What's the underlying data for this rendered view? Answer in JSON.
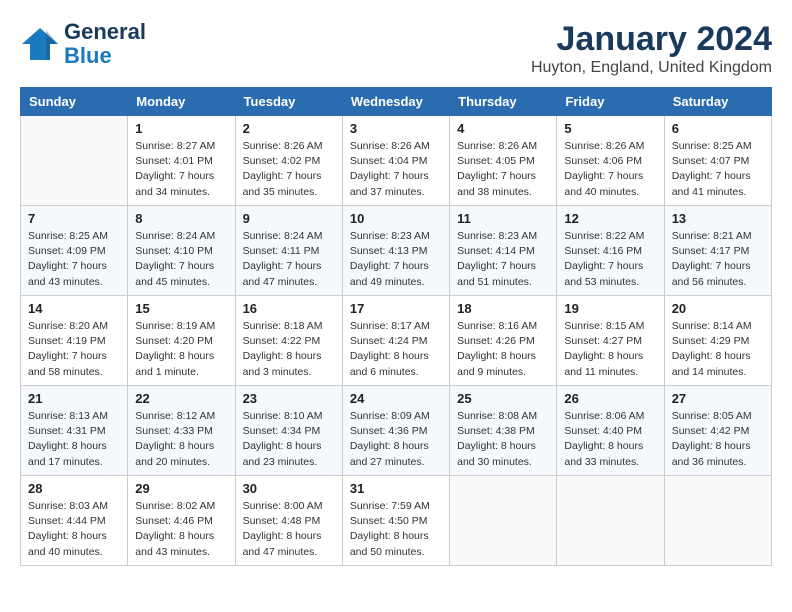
{
  "header": {
    "logo_line1": "General",
    "logo_line2": "Blue",
    "month_year": "January 2024",
    "location": "Huyton, England, United Kingdom"
  },
  "days_of_week": [
    "Sunday",
    "Monday",
    "Tuesday",
    "Wednesday",
    "Thursday",
    "Friday",
    "Saturday"
  ],
  "weeks": [
    [
      {
        "day": "",
        "info": ""
      },
      {
        "day": "1",
        "info": "Sunrise: 8:27 AM\nSunset: 4:01 PM\nDaylight: 7 hours\nand 34 minutes."
      },
      {
        "day": "2",
        "info": "Sunrise: 8:26 AM\nSunset: 4:02 PM\nDaylight: 7 hours\nand 35 minutes."
      },
      {
        "day": "3",
        "info": "Sunrise: 8:26 AM\nSunset: 4:04 PM\nDaylight: 7 hours\nand 37 minutes."
      },
      {
        "day": "4",
        "info": "Sunrise: 8:26 AM\nSunset: 4:05 PM\nDaylight: 7 hours\nand 38 minutes."
      },
      {
        "day": "5",
        "info": "Sunrise: 8:26 AM\nSunset: 4:06 PM\nDaylight: 7 hours\nand 40 minutes."
      },
      {
        "day": "6",
        "info": "Sunrise: 8:25 AM\nSunset: 4:07 PM\nDaylight: 7 hours\nand 41 minutes."
      }
    ],
    [
      {
        "day": "7",
        "info": "Sunrise: 8:25 AM\nSunset: 4:09 PM\nDaylight: 7 hours\nand 43 minutes."
      },
      {
        "day": "8",
        "info": "Sunrise: 8:24 AM\nSunset: 4:10 PM\nDaylight: 7 hours\nand 45 minutes."
      },
      {
        "day": "9",
        "info": "Sunrise: 8:24 AM\nSunset: 4:11 PM\nDaylight: 7 hours\nand 47 minutes."
      },
      {
        "day": "10",
        "info": "Sunrise: 8:23 AM\nSunset: 4:13 PM\nDaylight: 7 hours\nand 49 minutes."
      },
      {
        "day": "11",
        "info": "Sunrise: 8:23 AM\nSunset: 4:14 PM\nDaylight: 7 hours\nand 51 minutes."
      },
      {
        "day": "12",
        "info": "Sunrise: 8:22 AM\nSunset: 4:16 PM\nDaylight: 7 hours\nand 53 minutes."
      },
      {
        "day": "13",
        "info": "Sunrise: 8:21 AM\nSunset: 4:17 PM\nDaylight: 7 hours\nand 56 minutes."
      }
    ],
    [
      {
        "day": "14",
        "info": "Sunrise: 8:20 AM\nSunset: 4:19 PM\nDaylight: 7 hours\nand 58 minutes."
      },
      {
        "day": "15",
        "info": "Sunrise: 8:19 AM\nSunset: 4:20 PM\nDaylight: 8 hours\nand 1 minute."
      },
      {
        "day": "16",
        "info": "Sunrise: 8:18 AM\nSunset: 4:22 PM\nDaylight: 8 hours\nand 3 minutes."
      },
      {
        "day": "17",
        "info": "Sunrise: 8:17 AM\nSunset: 4:24 PM\nDaylight: 8 hours\nand 6 minutes."
      },
      {
        "day": "18",
        "info": "Sunrise: 8:16 AM\nSunset: 4:26 PM\nDaylight: 8 hours\nand 9 minutes."
      },
      {
        "day": "19",
        "info": "Sunrise: 8:15 AM\nSunset: 4:27 PM\nDaylight: 8 hours\nand 11 minutes."
      },
      {
        "day": "20",
        "info": "Sunrise: 8:14 AM\nSunset: 4:29 PM\nDaylight: 8 hours\nand 14 minutes."
      }
    ],
    [
      {
        "day": "21",
        "info": "Sunrise: 8:13 AM\nSunset: 4:31 PM\nDaylight: 8 hours\nand 17 minutes."
      },
      {
        "day": "22",
        "info": "Sunrise: 8:12 AM\nSunset: 4:33 PM\nDaylight: 8 hours\nand 20 minutes."
      },
      {
        "day": "23",
        "info": "Sunrise: 8:10 AM\nSunset: 4:34 PM\nDaylight: 8 hours\nand 23 minutes."
      },
      {
        "day": "24",
        "info": "Sunrise: 8:09 AM\nSunset: 4:36 PM\nDaylight: 8 hours\nand 27 minutes."
      },
      {
        "day": "25",
        "info": "Sunrise: 8:08 AM\nSunset: 4:38 PM\nDaylight: 8 hours\nand 30 minutes."
      },
      {
        "day": "26",
        "info": "Sunrise: 8:06 AM\nSunset: 4:40 PM\nDaylight: 8 hours\nand 33 minutes."
      },
      {
        "day": "27",
        "info": "Sunrise: 8:05 AM\nSunset: 4:42 PM\nDaylight: 8 hours\nand 36 minutes."
      }
    ],
    [
      {
        "day": "28",
        "info": "Sunrise: 8:03 AM\nSunset: 4:44 PM\nDaylight: 8 hours\nand 40 minutes."
      },
      {
        "day": "29",
        "info": "Sunrise: 8:02 AM\nSunset: 4:46 PM\nDaylight: 8 hours\nand 43 minutes."
      },
      {
        "day": "30",
        "info": "Sunrise: 8:00 AM\nSunset: 4:48 PM\nDaylight: 8 hours\nand 47 minutes."
      },
      {
        "day": "31",
        "info": "Sunrise: 7:59 AM\nSunset: 4:50 PM\nDaylight: 8 hours\nand 50 minutes."
      },
      {
        "day": "",
        "info": ""
      },
      {
        "day": "",
        "info": ""
      },
      {
        "day": "",
        "info": ""
      }
    ]
  ]
}
